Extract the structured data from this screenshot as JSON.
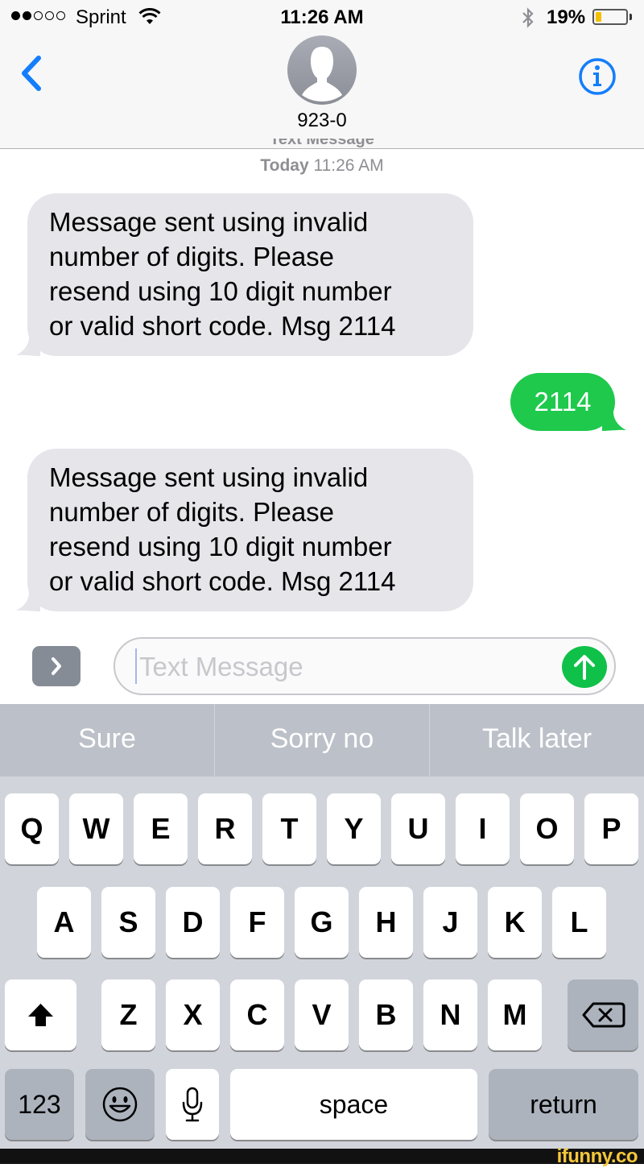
{
  "status_bar": {
    "signal_bars_filled": 2,
    "signal_bars_total": 5,
    "carrier": "Sprint",
    "time": "11:26 AM",
    "battery_percent_label": "19%",
    "battery_level": 0.19,
    "icons": [
      "wifi-icon",
      "bluetooth-icon",
      "battery-icon"
    ]
  },
  "header": {
    "back_icon": "chevron-left-icon",
    "contact_name": "923-0",
    "avatar_icon": "person-silhouette-icon",
    "info_icon": "info-icon"
  },
  "conversation": {
    "service_label": "Text Message",
    "timestamp_day": "Today",
    "timestamp_time": "11:26 AM",
    "messages": [
      {
        "direction": "incoming",
        "lines": [
          "Message sent using invalid",
          "number of digits. Please",
          "resend using 10 digit number",
          "or valid short code. Msg 2114"
        ]
      },
      {
        "direction": "outgoing",
        "text": "2114"
      },
      {
        "direction": "incoming",
        "lines": [
          "Message sent using invalid",
          "number of digits. Please",
          "resend using 10 digit number",
          "or valid short code. Msg 2114"
        ]
      }
    ]
  },
  "composer": {
    "apps_icon": "chevron-right-icon",
    "placeholder": "Text Message",
    "value": "",
    "send_icon": "arrow-up-icon"
  },
  "predictive": [
    "Sure",
    "Sorry no",
    "Talk later"
  ],
  "keyboard": {
    "row1": [
      "Q",
      "W",
      "E",
      "R",
      "T",
      "Y",
      "U",
      "I",
      "O",
      "P"
    ],
    "row2": [
      "A",
      "S",
      "D",
      "F",
      "G",
      "H",
      "J",
      "K",
      "L"
    ],
    "row3": [
      "Z",
      "X",
      "C",
      "V",
      "B",
      "N",
      "M"
    ],
    "numbers_label": "123",
    "space_label": "space",
    "return_label": "return",
    "shift_icon": "shift-icon",
    "delete_icon": "backspace-icon",
    "emoji_icon": "emoji-icon",
    "mic_icon": "microphone-icon"
  },
  "watermark": "ifunny.co",
  "colors": {
    "ios_blue": "#147efb",
    "imessage_green": "#1ec94c",
    "incoming_bubble": "#e5e5ea",
    "keyboard_bg": "#d1d5db",
    "battery_yellow": "#f5c000"
  }
}
